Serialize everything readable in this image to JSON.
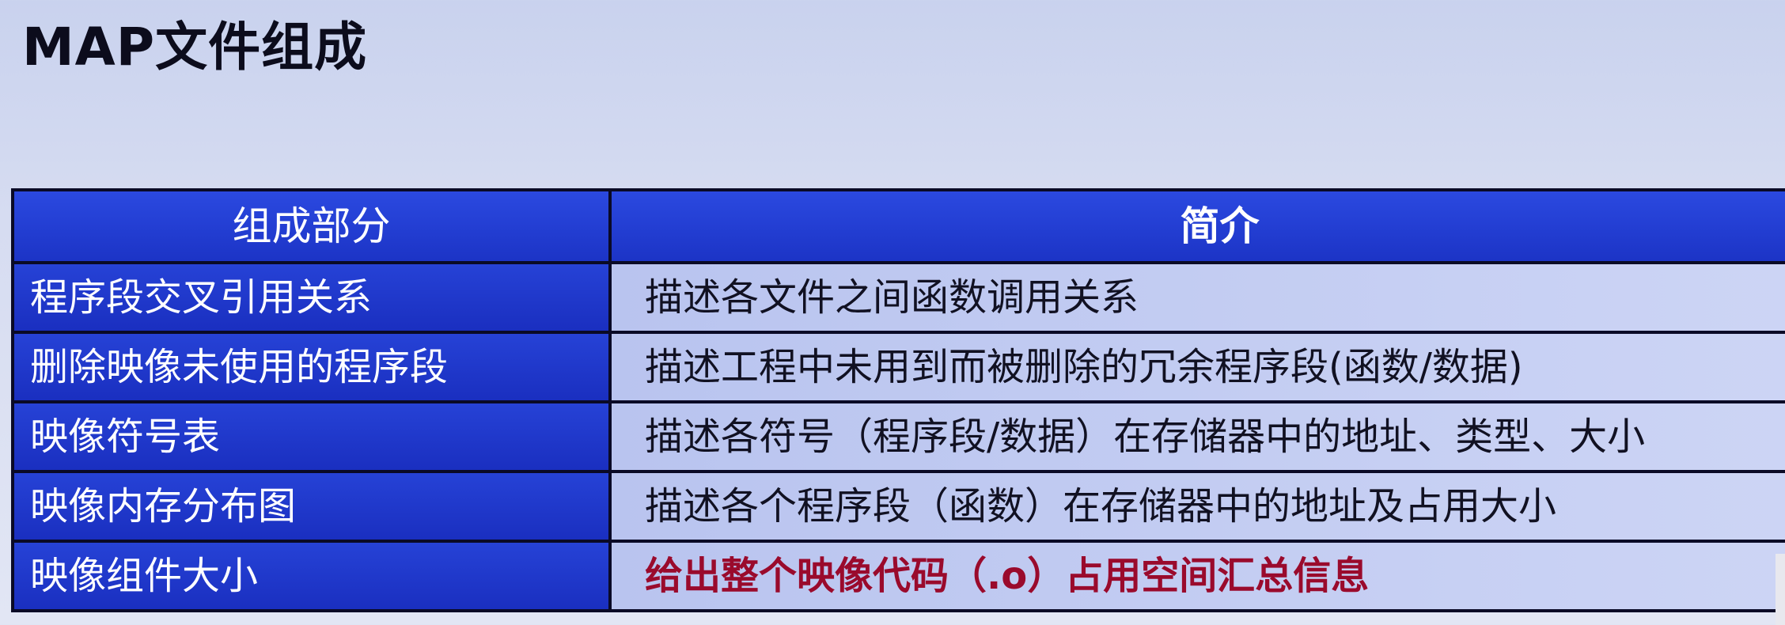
{
  "slide": {
    "title": "MAP文件组成"
  },
  "table": {
    "headers": [
      "组成部分",
      "简介"
    ],
    "rows": [
      {
        "part": "程序段交叉引用关系",
        "description": "描述各文件之间函数调用关系"
      },
      {
        "part": "删除映像未使用的程序段",
        "description": "描述工程中未用到而被删除的冗余程序段(函数/数据)"
      },
      {
        "part": "映像符号表",
        "description": "描述各符号（程序段/数据）在存储器中的地址、类型、大小"
      },
      {
        "part": "映像内存分布图",
        "description": "描述各个程序段（函数）在存储器中的地址及占用大小"
      },
      {
        "part": "映像组件大小",
        "description": "给出整个映像代码（.o）占用空间汇总信息",
        "highlight": true
      }
    ]
  },
  "colors": {
    "header_bg": "#1f39cc",
    "part_col_bg": "#1a2fc0",
    "desc_col_bg": "#c3ccf2",
    "highlight_text": "#9a0a2c",
    "border": "#0a0a26"
  }
}
